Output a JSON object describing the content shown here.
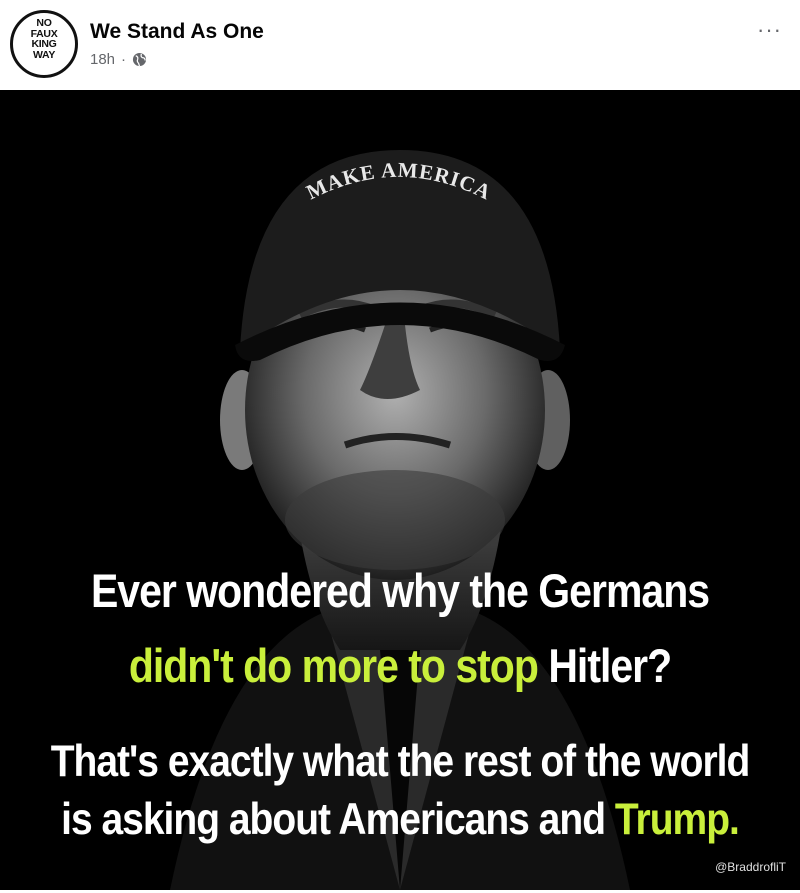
{
  "post": {
    "avatar_lines": [
      "NO",
      "FAUX",
      "KING",
      "WAY"
    ],
    "page_name": "We Stand As One",
    "time": "18h",
    "separator": "·",
    "privacy_icon": "globe-icon",
    "more_icon": "more-options-icon",
    "more_label": "···"
  },
  "image": {
    "hat_text": "MAKE AMERICA",
    "line1": "Ever wondered why the Germans",
    "line2_highlight": "didn't do more to stop",
    "line2_rest": "Hitler?",
    "line3": "That's exactly what the rest of the world",
    "line4_start": "is asking about Americans and",
    "line4_highlight": "Trump.",
    "credit": "@BraddrofliT",
    "colors": {
      "highlight": "#c9ef3b",
      "text": "#ffffff",
      "background": "#000000"
    }
  }
}
